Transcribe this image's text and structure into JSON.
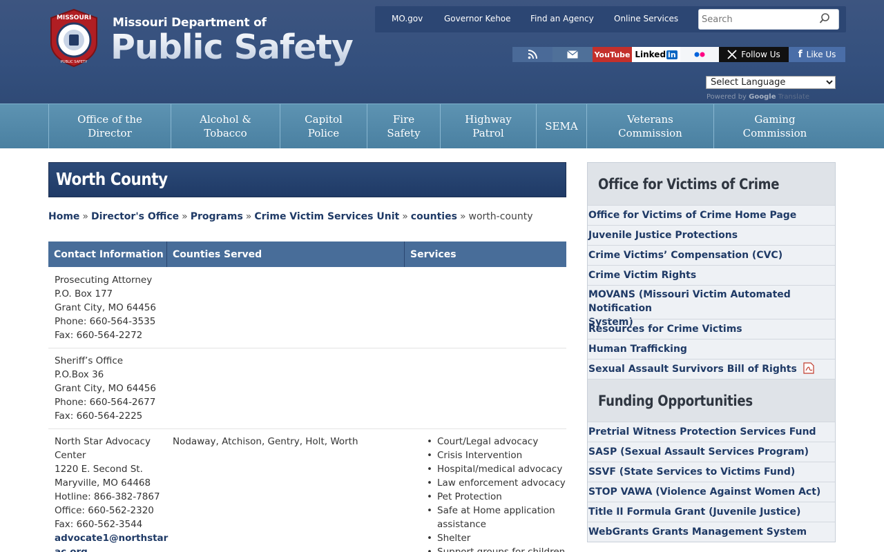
{
  "header": {
    "brand_top": "Missouri Department of",
    "brand_main": "Public Safety",
    "seal_text_top": "MISSOURI",
    "seal_text_bottom": "PUBLIC SAFETY",
    "utility_links": [
      "MO.gov",
      "Governor Kehoe",
      "Find an Agency",
      "Online Services"
    ],
    "search_placeholder": "Search",
    "social": {
      "youtube": "YouTube",
      "linkedin": "Linked",
      "linkedin_in": "in",
      "x_label": "Follow Us",
      "facebook_label": "Like Us"
    },
    "language_select": "Select Language",
    "powered_by": "Powered by",
    "google": "Google",
    "translate": "Translate"
  },
  "nav": [
    {
      "line1": "Office of the",
      "line2": "Director"
    },
    {
      "line1": "Alcohol &",
      "line2": "Tobacco"
    },
    {
      "line1": "Capitol",
      "line2": "Police"
    },
    {
      "line1": "Fire",
      "line2": "Safety"
    },
    {
      "line1": "Highway",
      "line2": "Patrol"
    },
    {
      "line1": "SEMA",
      "line2": ""
    },
    {
      "line1": "Veterans",
      "line2": "Commission"
    },
    {
      "line1": "Gaming",
      "line2": "Commission"
    }
  ],
  "page": {
    "title": "Worth County",
    "breadcrumb": {
      "items": [
        "Home",
        "Director's Office",
        "Programs",
        "Crime Victim Services Unit",
        "counties"
      ],
      "separator": "»",
      "current": "worth-county"
    }
  },
  "table": {
    "headers": [
      "Contact Information",
      "Counties Served",
      "Services"
    ],
    "rows": [
      {
        "contact": [
          "Prosecuting Attorney",
          "P.O. Box 177",
          "Grant City, MO 64456",
          "Phone: 660-564-3535",
          "Fax: 660-564-2272"
        ],
        "counties": "",
        "services": []
      },
      {
        "contact": [
          "Sheriff’s Office",
          "P.O.Box 36",
          "Grant City, MO 64456",
          "Phone: 660-564-2677",
          "Fax: 660-564-2225"
        ],
        "counties": "",
        "services": []
      },
      {
        "contact": [
          "North Star Advocacy",
          "Center",
          "1220 E. Second St.",
          "Maryville, MO 64468",
          "Hotline: 866-382-7867",
          "Office: 660-562-2320",
          "Fax: 660-562-3544"
        ],
        "email_line1": "advocate1@northstar",
        "email_line2": "ac.org",
        "counties": "Nodaway, Atchison, Gentry, Holt, Worth",
        "services": [
          "Court/Legal advocacy",
          "Crisis Intervention",
          "Hospital/medical advocacy",
          "Law enforcement advocacy",
          "Pet Protection",
          "Safe at Home application",
          "assistance",
          "Shelter",
          "Support groups for children"
        ]
      }
    ]
  },
  "sidebar": {
    "sections": [
      {
        "heading": "Office for Victims of Crime",
        "links": [
          "Office for Victims of Crime Home Page",
          "Juvenile Justice Protections",
          "Crime Victims’ Compensation (CVC)",
          "Crime Victim Rights",
          "MOVANS (Missouri Victim Automated Notification",
          "System)",
          "Resources for Crime Victims",
          "Human Trafficking",
          "Sexual Assault Survivors Bill of Rights"
        ]
      },
      {
        "heading": "Funding Opportunities",
        "links": [
          "Pretrial Witness Protection Services Fund",
          "SASP (Sexual Assault Services Program)",
          "SSVF (State Services to Victims Fund)",
          "STOP VAWA (Violence Against Women Act)",
          "Title II Formula Grant (Juvenile Justice)",
          "WebGrants Grants Management System"
        ]
      }
    ]
  }
}
